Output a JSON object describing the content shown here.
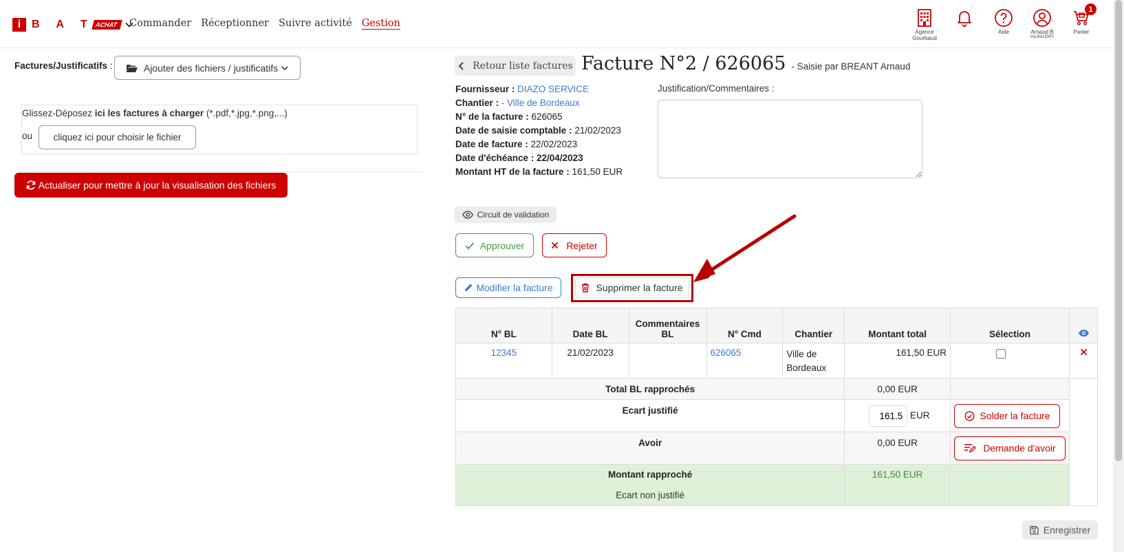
{
  "nav": {
    "logo_letter": "i",
    "logo_brand": "B A T",
    "logo_tag": "ACHAT",
    "menu": [
      "Commander",
      "Réceptionner",
      "Suivre activité",
      "Gestion"
    ],
    "agence_label_1": "Agence",
    "agence_label_2": "Gourbaud",
    "aide_label": "Aide",
    "user_label_1": "Arnaud B",
    "user_label_2": "Via BAUDRY",
    "panier_label": "Panier",
    "cart_count": "1"
  },
  "left": {
    "files_label": "Factures/Justificatifs",
    "files_sep": " :",
    "add_files_button": "Ajouter des fichiers / justificatifs",
    "drop_text_pre": "Glissez-Déposez ",
    "drop_text_bold": "ici les factures à charger",
    "drop_text_post": " (*.pdf,*.jpg,*.png,...)",
    "or_label": "ou",
    "choose_file_button": "cliquez ici pour choisir le fichier",
    "refresh_button": "Actualiser pour mettre à jour la visualisation des fichiers"
  },
  "invoice": {
    "back_button": "Retour liste factures",
    "title": "Facture N°2 / 626065",
    "subtitle": "- Saisie par BREANT Arnaud",
    "fournisseur_label": "Fournisseur :",
    "fournisseur_value": "DIAZO SERVICE",
    "chantier_label": "Chantier :",
    "chantier_value": "- Ville de Bordeaux",
    "numero_label": "N° de la facture :",
    "numero_value": "626065",
    "date_saisie_label": "Date de saisie comptable :",
    "date_saisie_value": "21/02/2023",
    "date_facture_label": "Date de facture :",
    "date_facture_value": "22/02/2023",
    "date_echeance_label": "Date d'échéance :",
    "date_echeance_value": "22/04/2023",
    "montant_label": "Montant HT de la facture :",
    "montant_value": "161,50 EUR",
    "comments_label": "Justification/Commentaires :",
    "comments_value": "",
    "circuit_button": "Circuit de validation",
    "approve_button": "Approuver",
    "reject_button": "Rejeter",
    "edit_button": "Modifier la facture",
    "delete_button": "Supprimer la facture",
    "save_button": "Enregistrer"
  },
  "table": {
    "headers": [
      "N° BL",
      "Date BL",
      "Commentaires BL",
      "N° Cmd",
      "Chantier",
      "Montant total",
      "Sélection"
    ],
    "header_comments_1": "Commentaires",
    "header_comments_2": "BL",
    "row": {
      "bl": "12345",
      "date": "21/02/2023",
      "comment": "",
      "cmd": "626065",
      "chantier_1": "Ville de",
      "chantier_2": "Bordeaux",
      "montant": "161,50 EUR",
      "selected": false
    },
    "total_label": "Total BL rapprochés",
    "total_value": "0,00 EUR",
    "ecart_label": "Ecart justifié",
    "ecart_input": "161.5",
    "ecart_unit": "EUR",
    "solder_button": "Solder la facture",
    "avoir_label": "Avoir",
    "avoir_value": "0,00 EUR",
    "avoir_button": "Demande d'avoir",
    "rapproche_label": "Montant rapproché",
    "rapproche_value": "161,50 EUR",
    "non_justifie_label": "Ecart non justifié"
  },
  "colors": {
    "brand_red": "#cc0000",
    "link_blue": "#3a7bd5",
    "approve_green": "#4a9a4a",
    "success_bg": "#dff0d8"
  }
}
